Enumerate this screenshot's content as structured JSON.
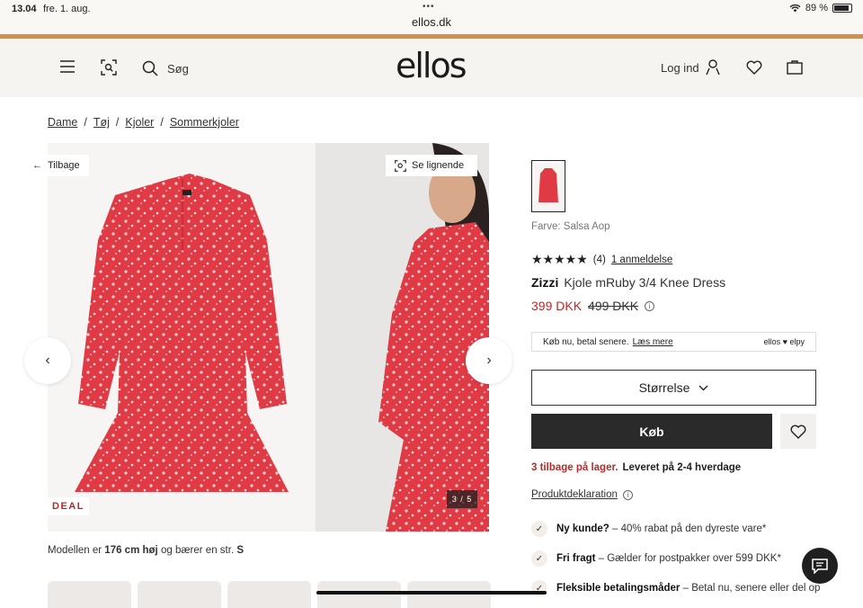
{
  "status_bar": {
    "time": "13.04",
    "date": "fre. 1. aug.",
    "url": "ellos.dk",
    "battery": "89 %"
  },
  "header": {
    "search_placeholder": "Søg",
    "logo": "ellos",
    "login": "Log ind"
  },
  "breadcrumb": [
    "Dame",
    "Tøj",
    "Kjoler",
    "Sommerkjoler"
  ],
  "gallery": {
    "back": "Tilbage",
    "similar": "Se lignende",
    "badge": "DEAL",
    "counter": "3 / 5",
    "model_note_prefix": "Modellen er",
    "model_height": "176 cm høj",
    "model_note_mid": "og bærer en str.",
    "model_size": "S"
  },
  "product": {
    "color_label": "Farve: Salsa Aop",
    "rating_value": 4.5,
    "stars": "★★★★★",
    "rating_count": "(4)",
    "reviews_link": "1 anmeldelse",
    "brand": "Zizzi",
    "name": "Kjole mRuby 3/4 Knee Dress",
    "price": "399 DKK",
    "old_price": "499 DKK",
    "pay_later": "Køb nu, betal senere.",
    "pay_later_link": "Læs mere",
    "pay_brand": "ellos ♥ elpy",
    "size_label": "Størrelse",
    "buy_label": "Køb",
    "stock": "3 tilbage på lager.",
    "delivery": "Leveret på 2-4 hverdage",
    "declaration": "Produktdeklaration"
  },
  "usps": [
    {
      "title": "Ny kunde?",
      "text": " – 40% rabat på den dyreste vare*"
    },
    {
      "title": "Fri fragt",
      "text": " – Gælder for postpakker over 599 DKK*"
    },
    {
      "title": "Fleksible betalingsmåder",
      "text": " – Betal nu, senere eller del op"
    }
  ],
  "colors": {
    "accent_strip": "#c9925d",
    "price_red": "#b52a2a",
    "dress_red": "#e03a44"
  }
}
